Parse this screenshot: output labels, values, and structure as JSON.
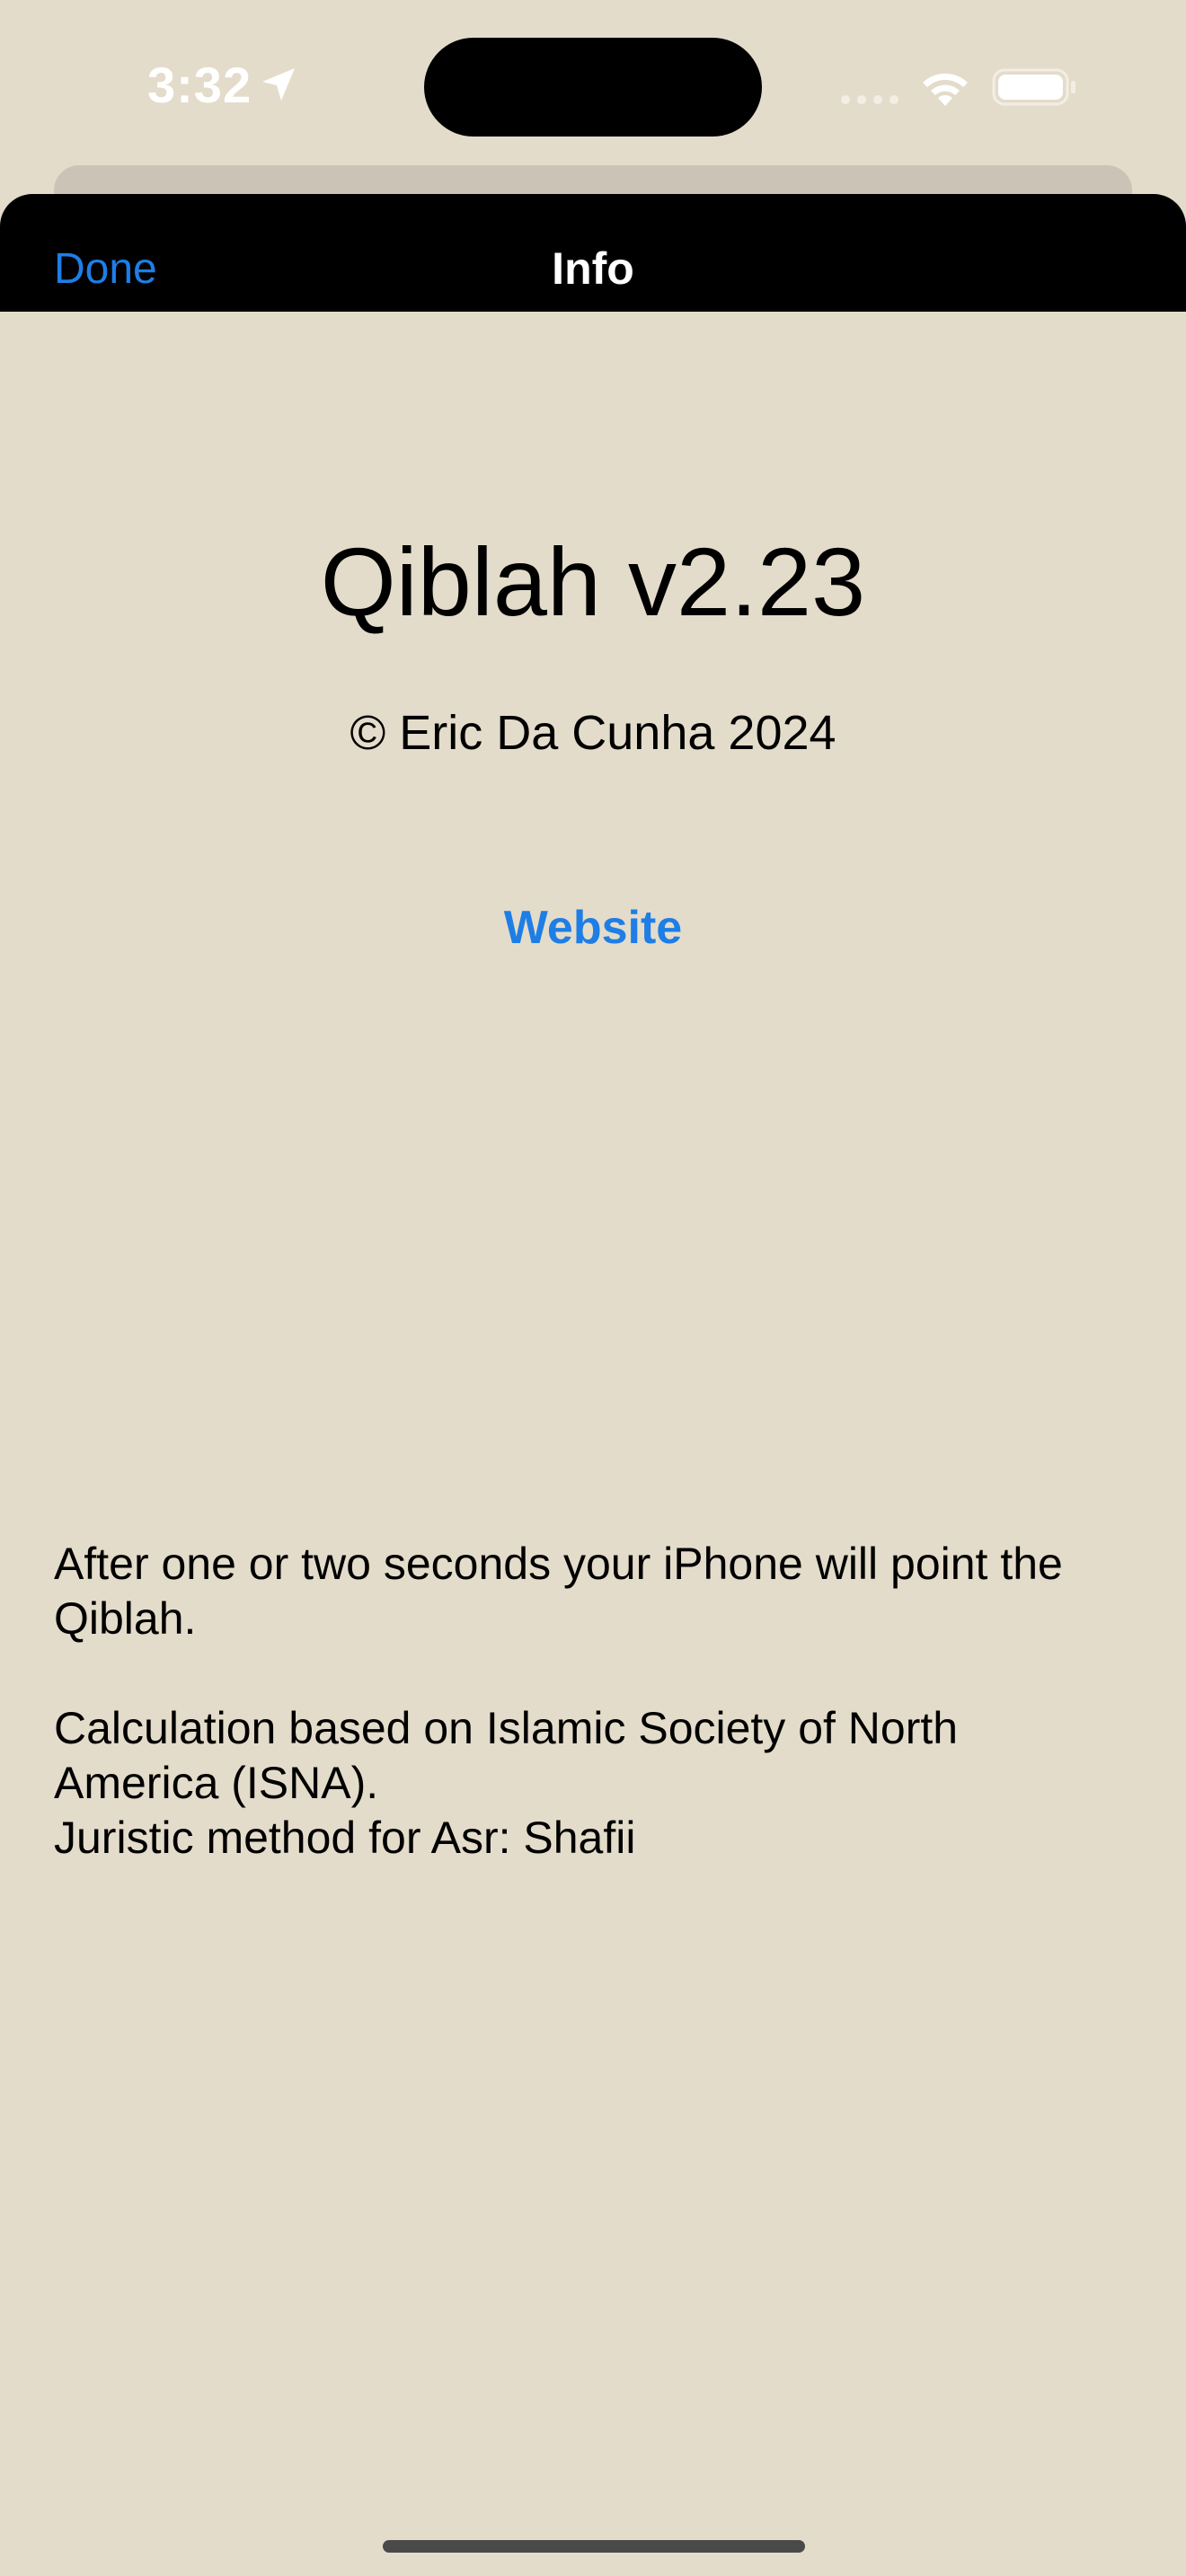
{
  "status_bar": {
    "time": "3:32"
  },
  "nav": {
    "done_label": "Done",
    "title": "Info"
  },
  "main": {
    "app_title": "Qiblah v2.23",
    "copyright": "© Eric Da Cunha 2024",
    "website_label": "Website",
    "info_line1": "After one or two seconds your iPhone will point the Qiblah.",
    "info_line2": "Calculation based on Islamic Society of North America (ISNA).",
    "info_line3": "Juristic method for Asr: Shafii"
  },
  "colors": {
    "background": "#e4dcca",
    "nav_background": "#000000",
    "accent": "#1e7ee6",
    "text": "#000000"
  }
}
